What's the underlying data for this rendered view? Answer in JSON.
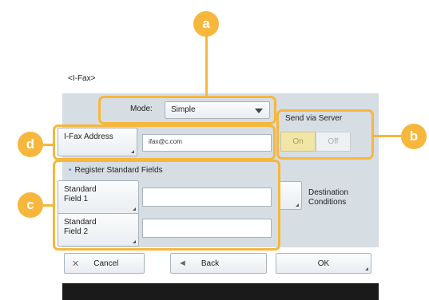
{
  "window": {
    "title": "<I-Fax>"
  },
  "mode": {
    "label": "Mode:",
    "value": "Simple"
  },
  "ifax": {
    "label": "I-Fax Address",
    "value": "ifax@c.com"
  },
  "send_via_server": {
    "label": "Send via Server",
    "on_label": "On",
    "off_label": "Off",
    "selected": "On"
  },
  "register": {
    "title": "Register Standard Fields",
    "fields": [
      {
        "label_line1": "Standard",
        "label_line2": "Field 1",
        "value": ""
      },
      {
        "label_line1": "Standard",
        "label_line2": "Field 2",
        "value": ""
      }
    ]
  },
  "destination": {
    "label_line1": "Destination",
    "label_line2": "Conditions"
  },
  "buttons": {
    "cancel": "Cancel",
    "back": "Back",
    "ok": "OK"
  },
  "callouts": {
    "a": "a",
    "b": "b",
    "c": "c",
    "d": "d"
  },
  "colors": {
    "callout": "#f6b73c",
    "panel": "#d6dde3",
    "toggle_on": "#f2e6a6"
  }
}
